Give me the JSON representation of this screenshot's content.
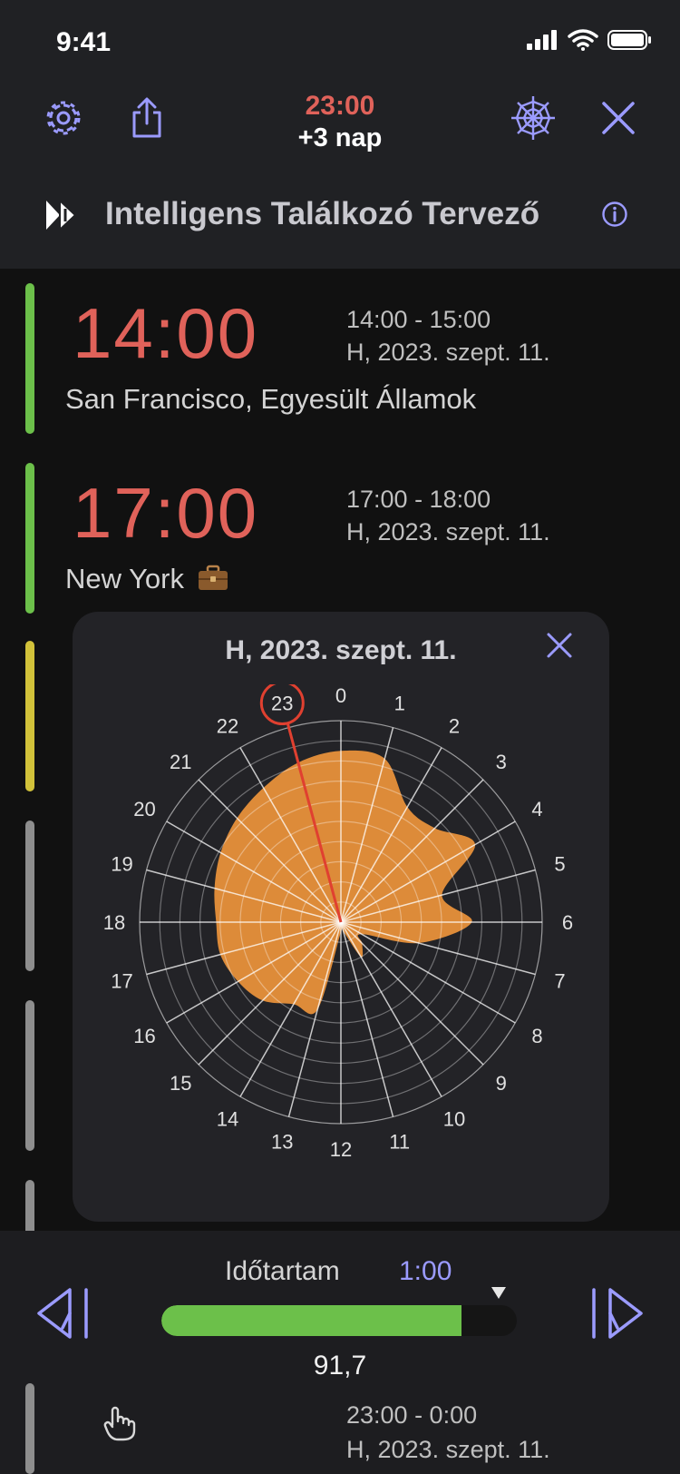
{
  "status_bar": {
    "time": "9:41"
  },
  "header": {
    "time": "23:00",
    "day_offset": "+3 nap",
    "app_title": "Intelligens Találkozó Tervező"
  },
  "colors": {
    "accent": "#9b9bff",
    "time": "#e0625a",
    "green": "#6cc04a",
    "yellow": "#d2c23a",
    "gray": "#8e8e8e",
    "chart_fill": "#e8913a",
    "highlight": "#e04030"
  },
  "rows": [
    {
      "time": "14:00",
      "range": "14:00 - 15:00",
      "date": "H, 2023. szept. 11.",
      "city": "San Francisco, Egyesült Államok",
      "bar_color": "#6cc04a"
    },
    {
      "time": "17:00",
      "range": "17:00 - 18:00",
      "date": "H, 2023. szept. 11.",
      "city": "New York",
      "city_icon": "briefcase-icon",
      "bar_color": "#6cc04a"
    }
  ],
  "popup": {
    "title": "H, 2023. szept. 11.",
    "close_icon": "close-icon"
  },
  "chart_data": {
    "type": "radar",
    "categories": [
      "0",
      "1",
      "2",
      "3",
      "4",
      "5",
      "6",
      "7",
      "8",
      "9",
      "10",
      "11",
      "12",
      "13",
      "14",
      "15",
      "16",
      "17",
      "18",
      "19",
      "20",
      "21",
      "22",
      "23"
    ],
    "values": [
      0.85,
      0.84,
      0.66,
      0.66,
      0.77,
      0.52,
      0.65,
      0.4,
      0.12,
      0.15,
      0.2,
      0.05,
      0.05,
      0.45,
      0.47,
      0.55,
      0.59,
      0.62,
      0.62,
      0.65,
      0.69,
      0.73,
      0.77,
      0.82
    ],
    "rlim": [
      0,
      1
    ],
    "highlighted": "23",
    "grid": true
  },
  "footer": {
    "duration_label": "Időtartam",
    "duration_value": "1:00",
    "score": "91,7",
    "score_fraction": 0.917,
    "peek_range": "23:00 - 0:00",
    "peek_date": "H, 2023. szept. 11."
  }
}
